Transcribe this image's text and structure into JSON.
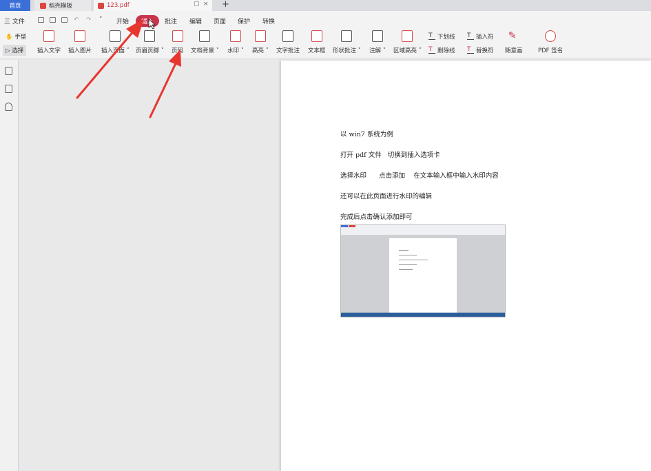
{
  "tabs": {
    "home": "首页",
    "template": "稻壳模板",
    "document": "123.pdf"
  },
  "menu": {
    "file": "三 文件",
    "items": [
      "开始",
      "插入",
      "批注",
      "编辑",
      "页面",
      "保护",
      "转换"
    ]
  },
  "modes": {
    "hand": "手型",
    "select": "选择"
  },
  "ribbon": {
    "tools": [
      "插入文字",
      "插入图片",
      "插入页面",
      "页眉页脚",
      "页码",
      "文档背景",
      "水印",
      "高亮",
      "文字批注",
      "文本框",
      "形状批注",
      "注解",
      "区域高亮"
    ],
    "dropdowns": [
      "插入页面",
      "页眉页脚",
      "文档背景",
      "水印",
      "高亮",
      "形状批注",
      "注解",
      "区域高亮"
    ],
    "small": {
      "underline": "下划线",
      "insert_mark": "插入符",
      "strikethrough": "删除线",
      "replace_mark": "替换符",
      "freehand": "随意画",
      "pdf_sign": "PDF 签名"
    }
  },
  "document": {
    "lines": [
      "以 win7 系统为例",
      "打开 pdf 文件   切换到插入选项卡",
      "选择水印      点击添加    在文本输入框中输入水印内容",
      "还可以在此页面进行水印的编辑",
      "完成后点击确认添加即可"
    ]
  },
  "colors": {
    "accent": "#c9344b",
    "tab_home": "#3b6fd8",
    "arrow": "#e8362f"
  },
  "icons": {
    "close": "×",
    "new_tab": "+",
    "dropdown": "˅"
  }
}
